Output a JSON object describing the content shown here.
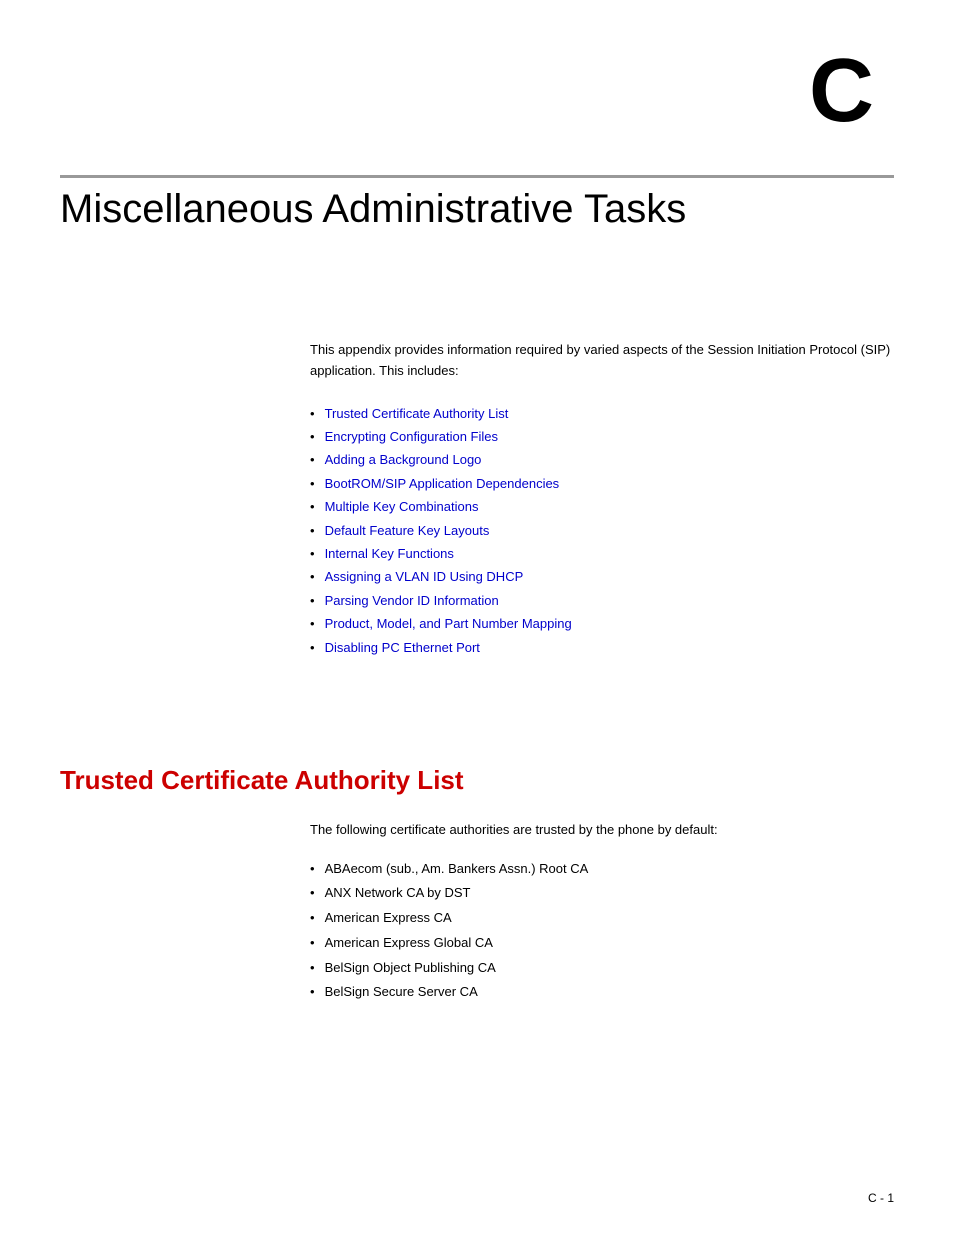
{
  "chapter": {
    "letter": "C",
    "title": "Miscellaneous Administrative Tasks",
    "intro_text": "This appendix provides information required by varied aspects of the Session Initiation Protocol (SIP) application. This includes:"
  },
  "toc": {
    "items": [
      {
        "label": "Trusted Certificate Authority List",
        "id": "toc-item-1"
      },
      {
        "label": "Encrypting Configuration Files",
        "id": "toc-item-2"
      },
      {
        "label": "Adding a Background Logo",
        "id": "toc-item-3"
      },
      {
        "label": "BootROM/SIP Application Dependencies",
        "id": "toc-item-4"
      },
      {
        "label": "Multiple Key Combinations",
        "id": "toc-item-5"
      },
      {
        "label": "Default Feature Key Layouts",
        "id": "toc-item-6"
      },
      {
        "label": "Internal Key Functions",
        "id": "toc-item-7"
      },
      {
        "label": "Assigning a VLAN ID Using DHCP",
        "id": "toc-item-8"
      },
      {
        "label": "Parsing Vendor ID Information",
        "id": "toc-item-9"
      },
      {
        "label": "Product, Model, and Part Number Mapping",
        "id": "toc-item-10"
      },
      {
        "label": "Disabling PC Ethernet Port",
        "id": "toc-item-11"
      }
    ]
  },
  "section": {
    "heading": "Trusted Certificate Authority List",
    "intro": "The following certificate authorities are trusted by the phone by default:",
    "cert_items": [
      "ABAecom (sub., Am. Bankers Assn.) Root CA",
      "ANX Network CA by DST",
      "American Express CA",
      "American Express Global CA",
      "BelSign Object Publishing CA",
      "BelSign Secure Server CA"
    ]
  },
  "footer": {
    "page_number": "C - 1"
  }
}
